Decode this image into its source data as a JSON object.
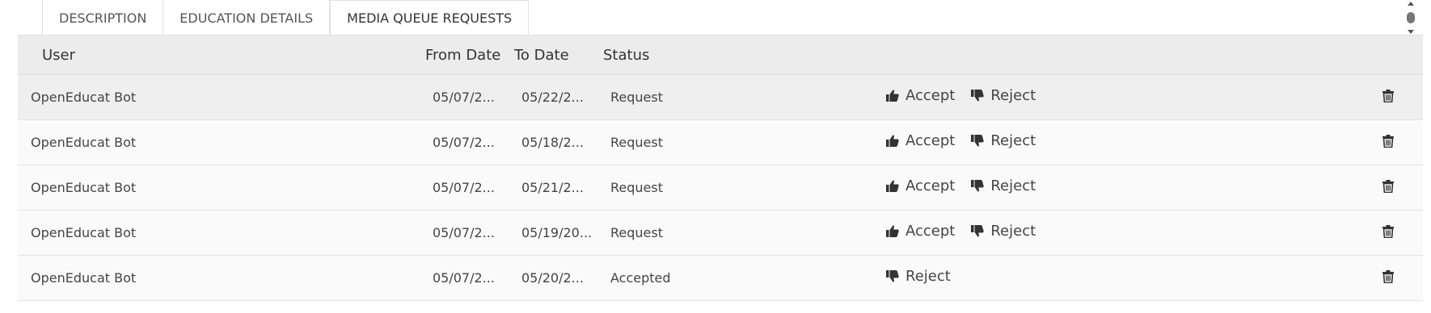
{
  "tabs": [
    {
      "label": "DESCRIPTION"
    },
    {
      "label": "EDUCATION DETAILS"
    },
    {
      "label": "MEDIA QUEUE REQUESTS",
      "active": true
    }
  ],
  "table": {
    "headers": {
      "user": "User",
      "from_date": "From Date",
      "to_date": "To Date",
      "status": "Status"
    },
    "action_labels": {
      "accept": "Accept",
      "reject": "Reject"
    },
    "rows": [
      {
        "user": "OpenEducat Bot",
        "from_date": "05/07/2...",
        "to_date": "05/22/2...",
        "status": "Request",
        "actions": [
          "accept",
          "reject"
        ]
      },
      {
        "user": "OpenEducat Bot",
        "from_date": "05/07/2...",
        "to_date": "05/18/2...",
        "status": "Request",
        "actions": [
          "accept",
          "reject"
        ]
      },
      {
        "user": "OpenEducat Bot",
        "from_date": "05/07/2...",
        "to_date": "05/21/2...",
        "status": "Request",
        "actions": [
          "accept",
          "reject"
        ]
      },
      {
        "user": "OpenEducat Bot",
        "from_date": "05/07/2...",
        "to_date": "05/19/20...",
        "status": "Request",
        "actions": [
          "accept",
          "reject"
        ]
      },
      {
        "user": "OpenEducat Bot",
        "from_date": "05/07/2...",
        "to_date": "05/20/2...",
        "status": "Accepted",
        "actions": [
          "reject"
        ]
      }
    ]
  },
  "icons": {
    "accept": "thumbs-up-icon",
    "reject": "thumbs-down-icon",
    "delete": "trash-icon"
  }
}
